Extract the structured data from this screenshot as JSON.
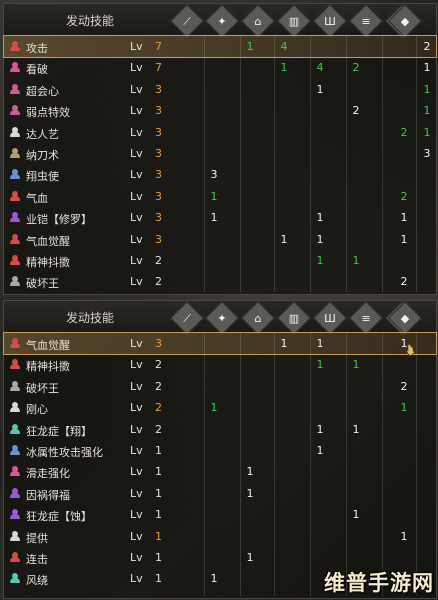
{
  "colors": {
    "attack": "#d64a4a",
    "blue": "#6b8fd9",
    "purple": "#9a5ad6",
    "pink": "#d05a9a",
    "white": "#d8d8d8",
    "tan": "#b59a6a",
    "teal": "#5ac8b0",
    "gray": "#a8a8a8"
  },
  "column_icons": [
    "longsword-icon",
    "charm-icon",
    "armor-head-icon",
    "armor-chest-icon",
    "armor-arms-icon",
    "armor-waist-icon",
    "armor-legs-icon",
    "decoration-icon"
  ],
  "panels": [
    {
      "header": "发动技能",
      "rows": [
        {
          "name": "攻击",
          "icon_color": "attack",
          "lv": "Lv",
          "level": "7",
          "level_color": "orange",
          "selected": true,
          "cells": [
            "",
            "1",
            "4",
            "",
            "",
            "",
            "",
            "2"
          ],
          "cell_colors": [
            "",
            "green",
            "green",
            "",
            "",
            "",
            "",
            "white"
          ]
        },
        {
          "name": "看破",
          "icon_color": "pink",
          "lv": "Lv",
          "level": "7",
          "level_color": "orange",
          "cells": [
            "",
            "",
            "1",
            "4",
            "2",
            "",
            "",
            "1"
          ],
          "cell_colors": [
            "",
            "",
            "green",
            "green",
            "green",
            "",
            "",
            "white"
          ]
        },
        {
          "name": "超会心",
          "icon_color": "pink",
          "lv": "Lv",
          "level": "3",
          "level_color": "orange",
          "cells": [
            "",
            "",
            "",
            "1",
            "",
            "",
            "",
            "1"
          ],
          "cell_colors": [
            "",
            "",
            "",
            "white",
            "",
            "",
            "",
            "green"
          ]
        },
        {
          "name": "弱点特效",
          "icon_color": "pink",
          "lv": "Lv",
          "level": "3",
          "level_color": "orange",
          "cells": [
            "",
            "",
            "",
            "",
            "2",
            "",
            "",
            "1"
          ],
          "cell_colors": [
            "",
            "",
            "",
            "",
            "white",
            "",
            "",
            "green"
          ]
        },
        {
          "name": "达人艺",
          "icon_color": "white",
          "lv": "Lv",
          "level": "3",
          "level_color": "orange",
          "cells": [
            "",
            "",
            "",
            "",
            "",
            "",
            "2",
            "1"
          ],
          "cell_colors": [
            "",
            "",
            "",
            "",
            "",
            "",
            "green",
            "green"
          ]
        },
        {
          "name": "纳刀术",
          "icon_color": "tan",
          "lv": "Lv",
          "level": "3",
          "level_color": "orange",
          "cells": [
            "",
            "",
            "",
            "",
            "",
            "",
            "",
            "3"
          ],
          "cell_colors": [
            "",
            "",
            "",
            "",
            "",
            "",
            "",
            "white"
          ]
        },
        {
          "name": "翔虫使",
          "icon_color": "blue",
          "lv": "Lv",
          "level": "3",
          "level_color": "orange",
          "cells": [
            "3",
            "",
            "",
            "",
            "",
            "",
            "",
            ""
          ],
          "cell_colors": [
            "white",
            "",
            "",
            "",
            "",
            "",
            "",
            ""
          ]
        },
        {
          "name": "气血",
          "icon_color": "attack",
          "lv": "Lv",
          "level": "3",
          "level_color": "orange",
          "cells": [
            "1",
            "",
            "",
            "",
            "",
            "",
            "2",
            ""
          ],
          "cell_colors": [
            "green",
            "",
            "",
            "",
            "",
            "",
            "green",
            ""
          ]
        },
        {
          "name": "业铠【修罗】",
          "icon_color": "purple",
          "lv": "Lv",
          "level": "3",
          "level_color": "orange",
          "cells": [
            "1",
            "",
            "",
            "1",
            "",
            "",
            "1",
            ""
          ],
          "cell_colors": [
            "white",
            "",
            "",
            "white",
            "",
            "",
            "white",
            ""
          ]
        },
        {
          "name": "气血觉醒",
          "icon_color": "attack",
          "lv": "Lv",
          "level": "3",
          "level_color": "orange",
          "cells": [
            "",
            "",
            "1",
            "1",
            "",
            "",
            "1",
            ""
          ],
          "cell_colors": [
            "",
            "",
            "white",
            "white",
            "",
            "",
            "white",
            ""
          ]
        },
        {
          "name": "精神抖擞",
          "icon_color": "attack",
          "lv": "Lv",
          "level": "2",
          "level_color": "white",
          "cells": [
            "",
            "",
            "",
            "1",
            "1",
            "",
            "",
            ""
          ],
          "cell_colors": [
            "",
            "",
            "",
            "green",
            "green",
            "",
            "",
            ""
          ]
        },
        {
          "name": "破坏王",
          "icon_color": "gray",
          "lv": "Lv",
          "level": "2",
          "level_color": "white",
          "cells": [
            "",
            "",
            "",
            "",
            "",
            "",
            "2",
            ""
          ],
          "cell_colors": [
            "",
            "",
            "",
            "",
            "",
            "",
            "white",
            ""
          ]
        }
      ]
    },
    {
      "header": "发动技能",
      "rows": [
        {
          "name": "气血觉醒",
          "icon_color": "attack",
          "lv": "Lv",
          "level": "3",
          "level_color": "orange",
          "selected": true,
          "cells": [
            "",
            "",
            "1",
            "1",
            "",
            "",
            "1",
            ""
          ],
          "cell_colors": [
            "",
            "",
            "white",
            "white",
            "",
            "",
            "white",
            ""
          ]
        },
        {
          "name": "精神抖擞",
          "icon_color": "attack",
          "lv": "Lv",
          "level": "2",
          "level_color": "white",
          "cells": [
            "",
            "",
            "",
            "1",
            "1",
            "",
            "",
            ""
          ],
          "cell_colors": [
            "",
            "",
            "",
            "green",
            "green",
            "",
            "",
            ""
          ]
        },
        {
          "name": "破坏王",
          "icon_color": "gray",
          "lv": "Lv",
          "level": "2",
          "level_color": "white",
          "cells": [
            "",
            "",
            "",
            "",
            "",
            "",
            "2",
            ""
          ],
          "cell_colors": [
            "",
            "",
            "",
            "",
            "",
            "",
            "white",
            ""
          ]
        },
        {
          "name": "刚心",
          "icon_color": "white",
          "lv": "Lv",
          "level": "2",
          "level_color": "orange",
          "cells": [
            "1",
            "",
            "",
            "",
            "",
            "",
            "1",
            ""
          ],
          "cell_colors": [
            "green",
            "",
            "",
            "",
            "",
            "",
            "green",
            ""
          ]
        },
        {
          "name": "狂龙症【翔】",
          "icon_color": "teal",
          "lv": "Lv",
          "level": "2",
          "level_color": "white",
          "cells": [
            "",
            "",
            "",
            "1",
            "1",
            "",
            "",
            ""
          ],
          "cell_colors": [
            "",
            "",
            "",
            "white",
            "white",
            "",
            "",
            ""
          ]
        },
        {
          "name": "冰属性攻击强化",
          "icon_color": "blue",
          "lv": "Lv",
          "level": "1",
          "level_color": "white",
          "cells": [
            "",
            "",
            "",
            "1",
            "",
            "",
            "",
            ""
          ],
          "cell_colors": [
            "",
            "",
            "",
            "white",
            "",
            "",
            "",
            ""
          ]
        },
        {
          "name": "滑走强化",
          "icon_color": "pink",
          "lv": "Lv",
          "level": "1",
          "level_color": "white",
          "cells": [
            "",
            "1",
            "",
            "",
            "",
            "",
            "",
            ""
          ],
          "cell_colors": [
            "",
            "white",
            "",
            "",
            "",
            "",
            "",
            ""
          ]
        },
        {
          "name": "因祸得福",
          "icon_color": "purple",
          "lv": "Lv",
          "level": "1",
          "level_color": "white",
          "cells": [
            "",
            "1",
            "",
            "",
            "",
            "",
            "",
            ""
          ],
          "cell_colors": [
            "",
            "white",
            "",
            "",
            "",
            "",
            "",
            ""
          ]
        },
        {
          "name": "狂龙症【蚀】",
          "icon_color": "purple",
          "lv": "Lv",
          "level": "1",
          "level_color": "white",
          "cells": [
            "",
            "",
            "",
            "",
            "1",
            "",
            "",
            ""
          ],
          "cell_colors": [
            "",
            "",
            "",
            "",
            "white",
            "",
            "",
            ""
          ]
        },
        {
          "name": "提供",
          "icon_color": "white",
          "lv": "Lv",
          "level": "1",
          "level_color": "orange",
          "cells": [
            "",
            "",
            "",
            "",
            "",
            "",
            "1",
            ""
          ],
          "cell_colors": [
            "",
            "",
            "",
            "",
            "",
            "",
            "white",
            ""
          ]
        },
        {
          "name": "连击",
          "icon_color": "attack",
          "lv": "Lv",
          "level": "1",
          "level_color": "white",
          "cells": [
            "",
            "1",
            "",
            "",
            "",
            "",
            "",
            ""
          ],
          "cell_colors": [
            "",
            "white",
            "",
            "",
            "",
            "",
            "",
            ""
          ]
        },
        {
          "name": "风绕",
          "icon_color": "teal",
          "lv": "Lv",
          "level": "1",
          "level_color": "white",
          "cells": [
            "1",
            "",
            "",
            "",
            "",
            "",
            "",
            ""
          ],
          "cell_colors": [
            "white",
            "",
            "",
            "",
            "",
            "",
            "",
            ""
          ]
        }
      ]
    }
  ],
  "watermark": "维普手游网"
}
